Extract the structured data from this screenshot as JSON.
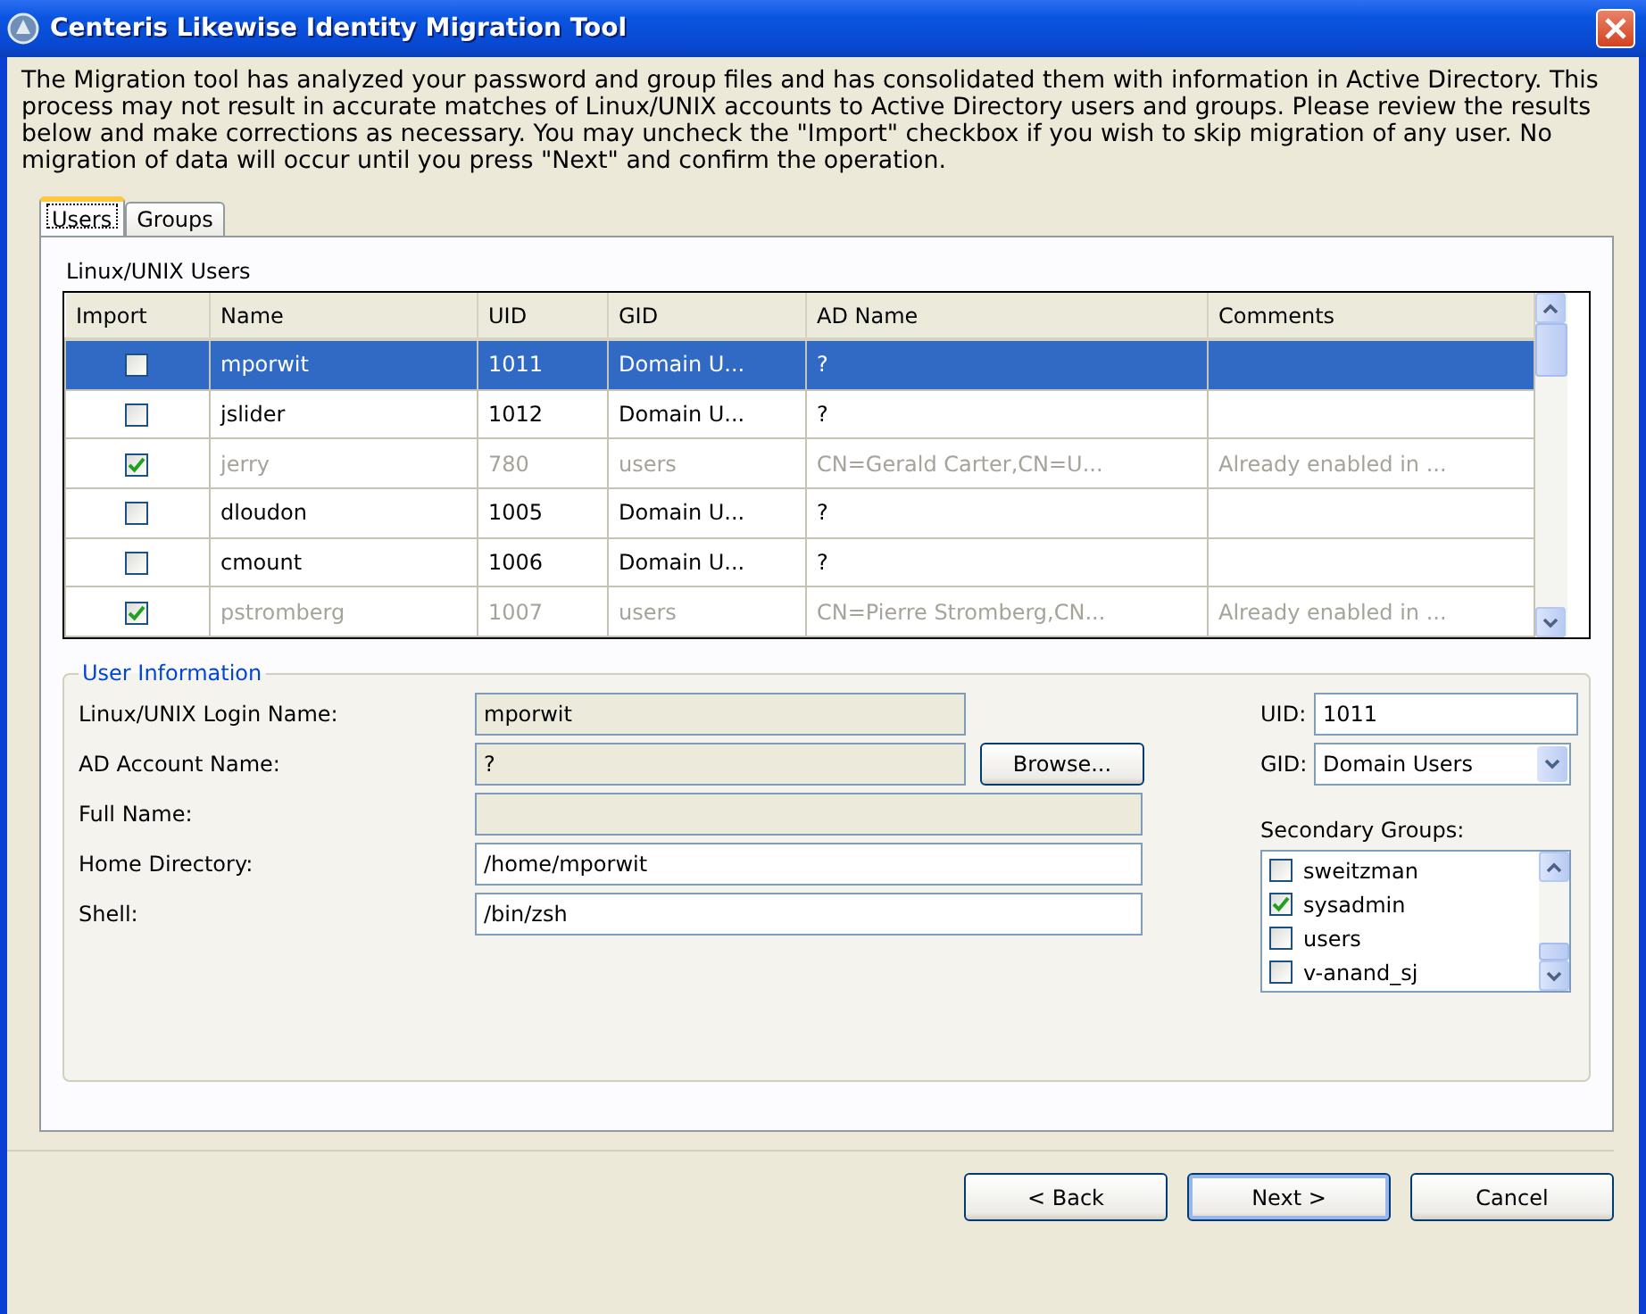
{
  "window": {
    "title": "Centeris Likewise Identity Migration Tool"
  },
  "description": "The Migration tool has analyzed your password and group files and has consolidated them with information in Active Directory. This process may not result in accurate matches of Linux/UNIX accounts to Active Directory users and groups. Please review the results below and make corrections as necessary. You may uncheck the \"Import\" checkbox if you wish to skip migration of any user. No migration of data will occur until you press \"Next\" and confirm the operation.",
  "tabs": [
    {
      "label": "Users",
      "selected": true
    },
    {
      "label": "Groups",
      "selected": false
    }
  ],
  "users_table": {
    "title": "Linux/UNIX Users",
    "columns": [
      "Import",
      "Name",
      "UID",
      "GID",
      "AD Name",
      "Comments"
    ],
    "rows": [
      {
        "import": false,
        "selected": true,
        "disabled": false,
        "name": "mporwit",
        "uid": "1011",
        "gid": "Domain U...",
        "ad_name": "?"
      },
      {
        "import": false,
        "selected": false,
        "disabled": false,
        "name": "jslider",
        "uid": "1012",
        "gid": "Domain U...",
        "ad_name": "?"
      },
      {
        "import": true,
        "selected": false,
        "disabled": true,
        "name": "jerry",
        "uid": "780",
        "gid": "users",
        "ad_name": "CN=Gerald Carter,CN=U...",
        "comments": "Already enabled in ..."
      },
      {
        "import": false,
        "selected": false,
        "disabled": false,
        "name": "dloudon",
        "uid": "1005",
        "gid": "Domain U...",
        "ad_name": "?"
      },
      {
        "import": false,
        "selected": false,
        "disabled": false,
        "name": "cmount",
        "uid": "1006",
        "gid": "Domain U...",
        "ad_name": "?"
      },
      {
        "import": true,
        "selected": false,
        "disabled": true,
        "name": "pstromberg",
        "uid": "1007",
        "gid": "users",
        "ad_name": "CN=Pierre Stromberg,CN...",
        "comments": "Already enabled in ..."
      }
    ]
  },
  "user_information": {
    "title": "User Information",
    "fields": [
      {
        "label": "Linux/UNIX Login Name:",
        "value": "mporwit",
        "disabled": true
      },
      {
        "label": "AD Account Name:",
        "value": "?",
        "disabled": true,
        "button": "Browse..."
      },
      {
        "label": "Full Name:",
        "disabled": true
      },
      {
        "label": "Home Directory:",
        "value": "/home/mporwit",
        "disabled": false
      },
      {
        "label": "Shell:",
        "value": "/bin/zsh",
        "disabled": false
      }
    ],
    "uid": {
      "label": "UID:",
      "value": "1011"
    },
    "gid": {
      "label": "GID:",
      "value": "Domain Users"
    },
    "secondary_groups": {
      "label": "Secondary Groups:",
      "items": [
        {
          "label": "sweitzman",
          "checked": false
        },
        {
          "label": "sysadmin",
          "checked": true
        },
        {
          "label": "users",
          "checked": false
        },
        {
          "label": "v-anand_sj",
          "checked": false
        }
      ]
    }
  },
  "buttons": [
    {
      "label": "< Back",
      "default": false
    },
    {
      "label": "Next >",
      "default": true
    },
    {
      "label": "Cancel",
      "default": false
    }
  ]
}
